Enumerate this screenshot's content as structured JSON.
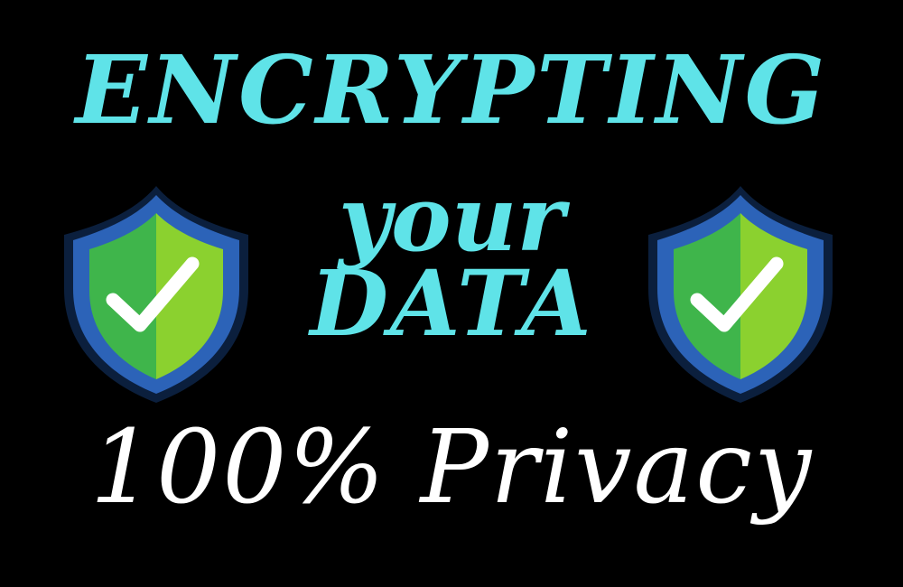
{
  "headline": {
    "line1": "ENCRYPTING",
    "line2": "your",
    "line3": "DATA"
  },
  "tagline": "100% Privacy",
  "icons": {
    "left": "shield-check-icon",
    "right": "shield-check-icon"
  },
  "colors": {
    "background": "#000000",
    "headline": "#5fe3e8",
    "tagline": "#ffffff",
    "shield_outer": "#2c63b8",
    "shield_border": "#0b1f3d",
    "shield_green_light": "#8bd12f",
    "shield_green_dark": "#3fb54b",
    "check": "#ffffff"
  }
}
